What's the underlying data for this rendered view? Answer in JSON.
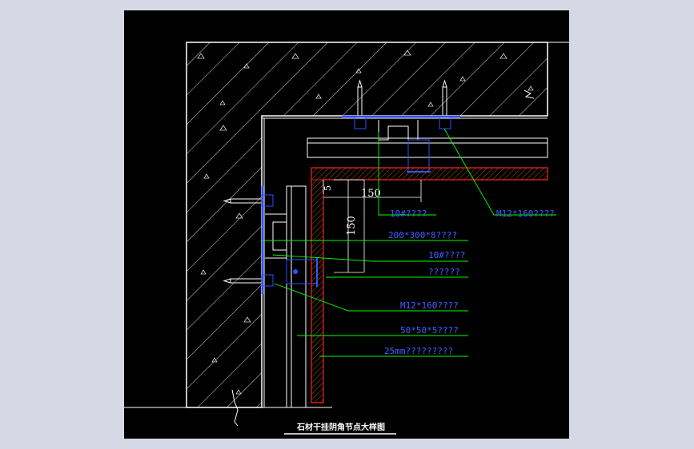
{
  "drawing": {
    "title": "石材干挂阴角节点大样图",
    "colors": {
      "background": "#000000",
      "frame": "#d7d8e5",
      "structure": "#ffffff",
      "hatch": "#d8d8d8",
      "leader": "#00ff00",
      "label": "#4060ff",
      "bracket": "#3050ff",
      "stone": "#ff2020",
      "stone_hatch": "#cc7000",
      "dimension": "#ffffff"
    },
    "dimensions": {
      "top_width": "150",
      "side_height": "150",
      "gap": "5"
    },
    "labels": {
      "l1": "10#????",
      "l2": "M12*160????",
      "l3": "200*300*8????",
      "l4": "10#????",
      "l5": "??????",
      "l6": "M12*160????",
      "l7": "50*50*5????",
      "l8": "25mm?????????"
    }
  }
}
